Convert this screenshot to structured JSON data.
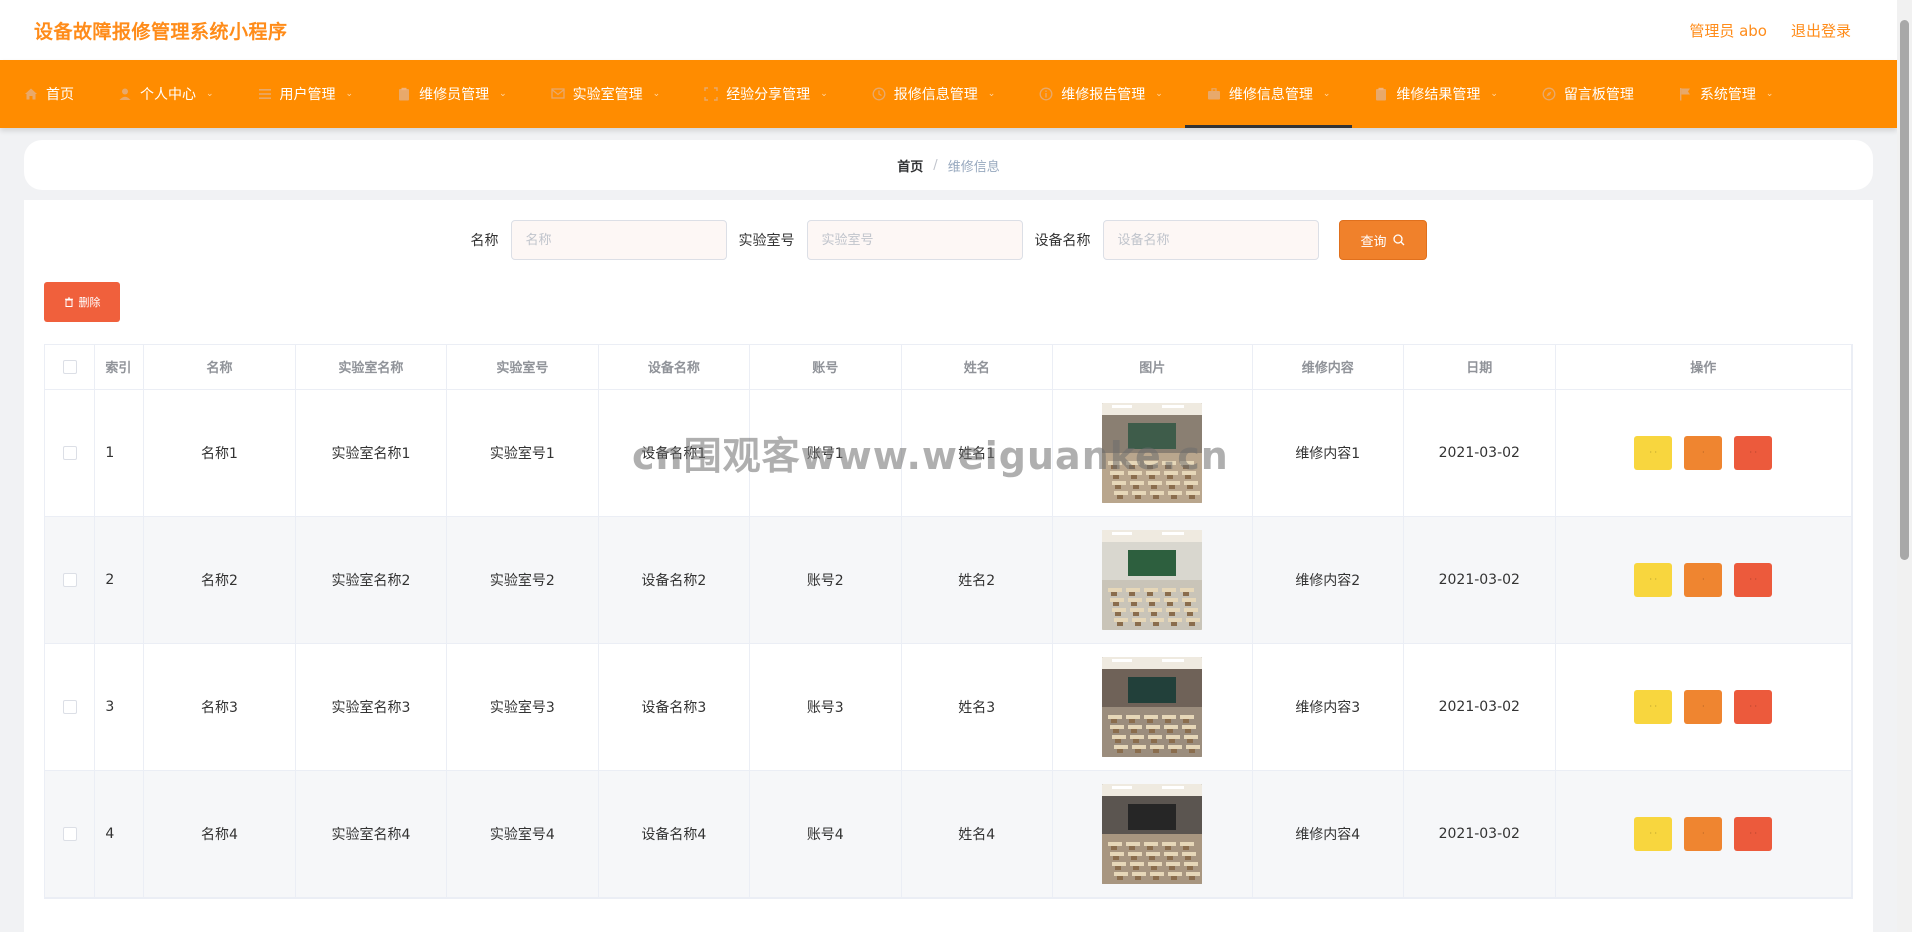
{
  "header": {
    "title": "设备故障报修管理系统小程序",
    "user": "管理员 abo",
    "logout": "退出登录"
  },
  "nav": {
    "items": [
      {
        "label": "首页",
        "icon": "home-icon",
        "dropdown": false
      },
      {
        "label": "个人中心",
        "icon": "user-icon",
        "dropdown": true
      },
      {
        "label": "用户管理",
        "icon": "list-icon",
        "dropdown": true
      },
      {
        "label": "维修员管理",
        "icon": "clipboard-icon",
        "dropdown": true
      },
      {
        "label": "实验室管理",
        "icon": "message-icon",
        "dropdown": true
      },
      {
        "label": "经验分享管理",
        "icon": "frame-icon",
        "dropdown": true
      },
      {
        "label": "报修信息管理",
        "icon": "clock-icon",
        "dropdown": true
      },
      {
        "label": "维修报告管理",
        "icon": "info-icon",
        "dropdown": true
      },
      {
        "label": "维修信息管理",
        "icon": "briefcase-icon",
        "dropdown": true,
        "active": true
      },
      {
        "label": "维修结果管理",
        "icon": "clipboard-icon",
        "dropdown": true
      },
      {
        "label": "留言板管理",
        "icon": "compass-icon",
        "dropdown": false
      },
      {
        "label": "系统管理",
        "icon": "flag-icon",
        "dropdown": true
      }
    ]
  },
  "breadcrumb": {
    "home": "首页",
    "separator": "/",
    "current": "维修信息"
  },
  "search": {
    "name_label": "名称",
    "name_placeholder": "名称",
    "lab_label": "实验室号",
    "lab_placeholder": "实验室号",
    "device_label": "设备名称",
    "device_placeholder": "设备名称",
    "query_label": "查询"
  },
  "actions": {
    "delete_label": "删除"
  },
  "table": {
    "columns": [
      "索引",
      "名称",
      "实验室名称",
      "实验室号",
      "设备名称",
      "账号",
      "姓名",
      "图片",
      "维修内容",
      "日期",
      "操作"
    ],
    "rows": [
      {
        "index": "1",
        "name": "名称1",
        "lab_name": "实验室名称1",
        "lab_no": "实验室号1",
        "device": "设备名称1",
        "account": "账号1",
        "person": "姓名1",
        "content": "维修内容1",
        "date": "2021-03-02"
      },
      {
        "index": "2",
        "name": "名称2",
        "lab_name": "实验室名称2",
        "lab_no": "实验室号2",
        "device": "设备名称2",
        "account": "账号2",
        "person": "姓名2",
        "content": "维修内容2",
        "date": "2021-03-02"
      },
      {
        "index": "3",
        "name": "名称3",
        "lab_name": "实验室名称3",
        "lab_no": "实验室号3",
        "device": "设备名称3",
        "account": "账号3",
        "person": "姓名3",
        "content": "维修内容3",
        "date": "2021-03-02"
      },
      {
        "index": "4",
        "name": "名称4",
        "lab_name": "实验室名称4",
        "lab_no": "实验室号4",
        "device": "设备名称4",
        "account": "账号4",
        "person": "姓名4",
        "content": "维修内容4",
        "date": "2021-03-02"
      }
    ],
    "op_labels": {
      "view": "· ·",
      "edit": "·",
      "delete": "· ·"
    }
  },
  "watermark": "cn围观客www.weiguanke.cn",
  "colors": {
    "brand": "#ff8c00",
    "title": "#ff8c1a",
    "query": "#f0812b",
    "delete": "#f0603c",
    "view_btn": "#f8d63e",
    "edit_btn": "#ef8530",
    "delete_btn": "#ec5a3c"
  }
}
